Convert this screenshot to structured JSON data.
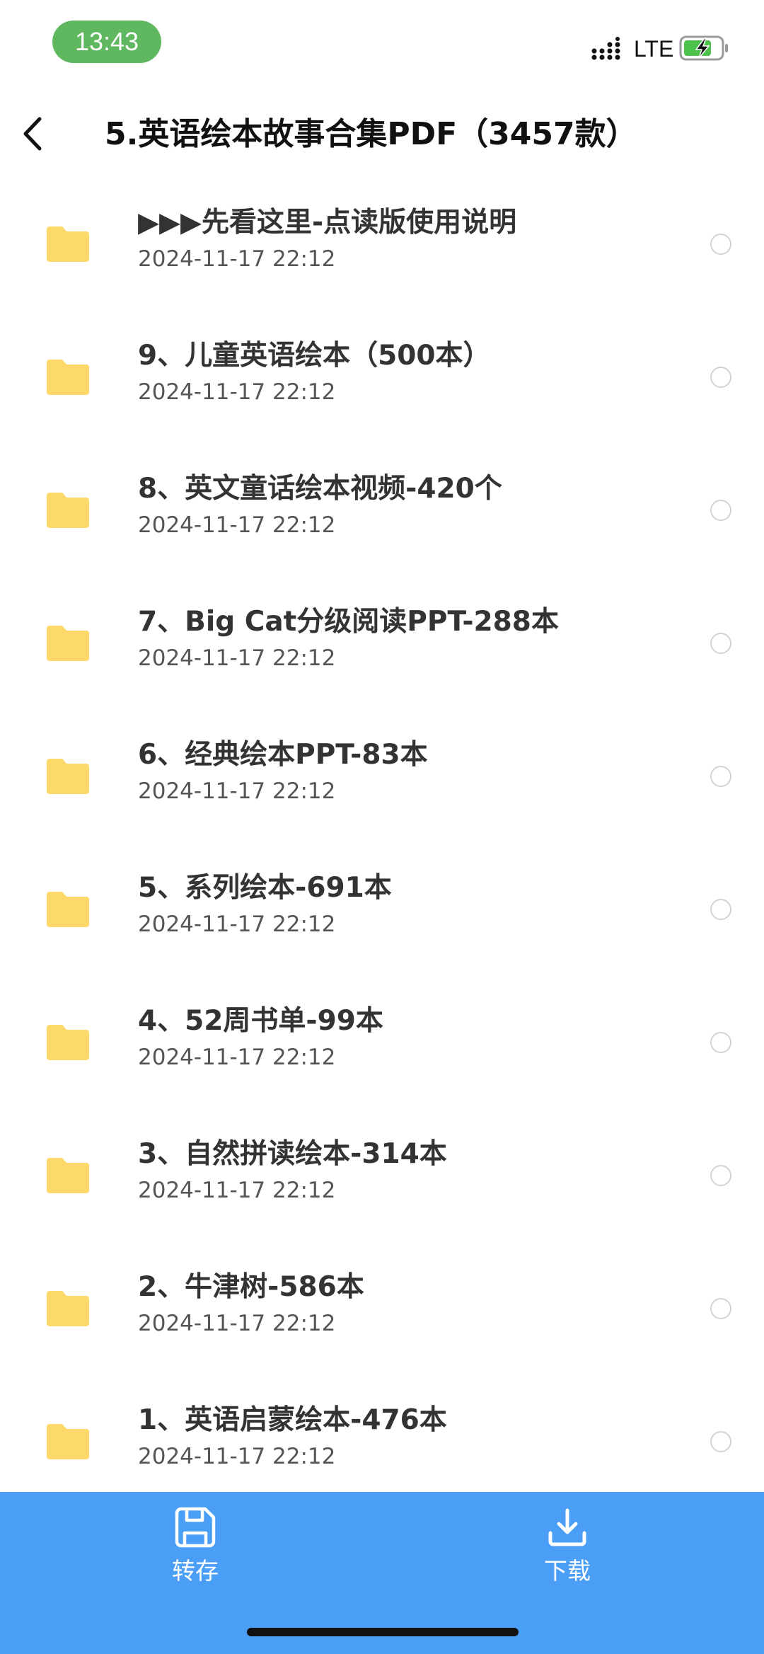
{
  "status_bar": {
    "time": "13:43",
    "network": "LTE",
    "time_pill_color": "#5fb85f",
    "signal_icon": "signal-bars-icon",
    "battery_icon": "battery-charging-icon"
  },
  "header": {
    "back_icon": "chevron-left-icon",
    "title": "5.英语绘本故事合集PDF（3457款）"
  },
  "folders": [
    {
      "name": "▶▶▶先看这里-点读版使用说明",
      "date": "2024-11-17 22:12"
    },
    {
      "name": "9、儿童英语绘本（500本）",
      "date": "2024-11-17 22:12"
    },
    {
      "name": "8、英文童话绘本视频-420个",
      "date": "2024-11-17 22:12"
    },
    {
      "name": "7、Big Cat分级阅读PPT-288本",
      "date": "2024-11-17 22:12"
    },
    {
      "name": "6、经典绘本PPT-83本",
      "date": "2024-11-17 22:12"
    },
    {
      "name": "5、系列绘本-691本",
      "date": "2024-11-17 22:12"
    },
    {
      "name": "4、52周书单-99本",
      "date": "2024-11-17 22:12"
    },
    {
      "name": "3、自然拼读绘本-314本",
      "date": "2024-11-17 22:12"
    },
    {
      "name": "2、牛津树-586本",
      "date": "2024-11-17 22:12"
    },
    {
      "name": "1、英语启蒙绘本-476本",
      "date": "2024-11-17 22:12"
    }
  ],
  "folder_icon": "folder-icon",
  "folder_color": "#fcd96a",
  "action_bar": {
    "color": "#4a9ef5",
    "save_label": "转存",
    "save_icon": "save-disk-icon",
    "download_label": "下载",
    "download_icon": "download-icon"
  }
}
